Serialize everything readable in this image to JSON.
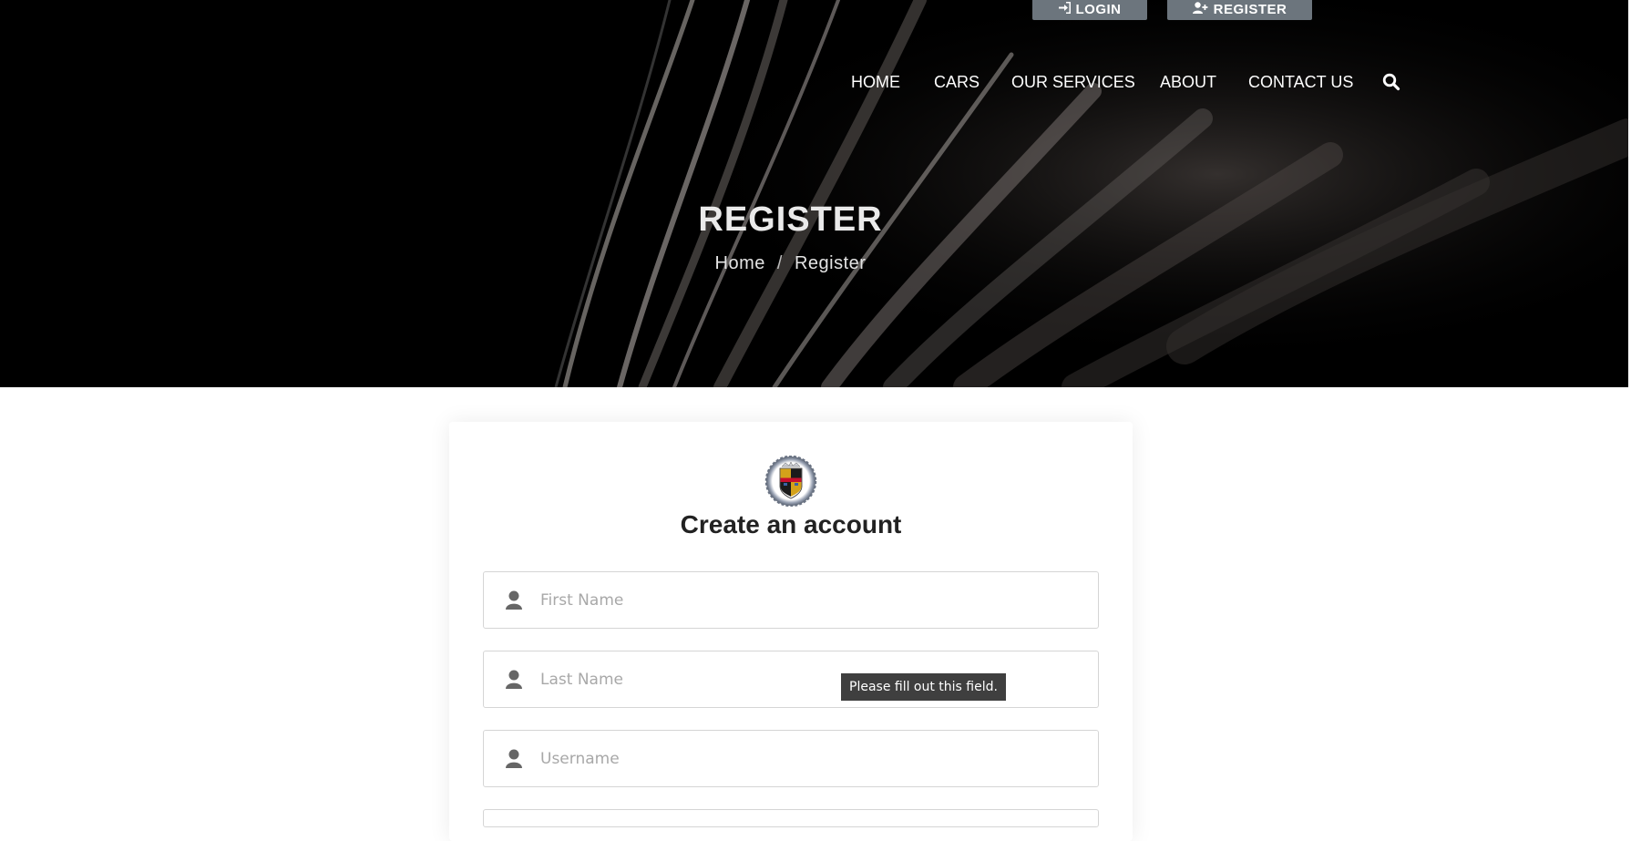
{
  "header": {
    "login_label": "LOGIN",
    "register_label": "REGISTER",
    "login_icon": "sign-in-icon",
    "register_icon": "user-plus-icon",
    "button_color": "#6c757d"
  },
  "nav": {
    "items": [
      {
        "label": "HOME"
      },
      {
        "label": "CARS"
      },
      {
        "label": "OUR SERVICES"
      },
      {
        "label": "ABOUT"
      },
      {
        "label": "CONTACT US"
      }
    ],
    "search_icon": "search-icon"
  },
  "hero": {
    "title": "REGISTER",
    "breadcrumb": {
      "home": "Home",
      "separator": "/",
      "current": "Register"
    }
  },
  "form": {
    "logo": "cadillac-crest-logo",
    "title": "Create an account",
    "fields": [
      {
        "placeholder": "First Name",
        "value": "",
        "icon": "user-icon"
      },
      {
        "placeholder": "Last Name",
        "value": "",
        "icon": "user-icon"
      },
      {
        "placeholder": "Username",
        "value": "",
        "icon": "user-icon"
      }
    ],
    "validation_tooltip": "Please fill out this field."
  }
}
